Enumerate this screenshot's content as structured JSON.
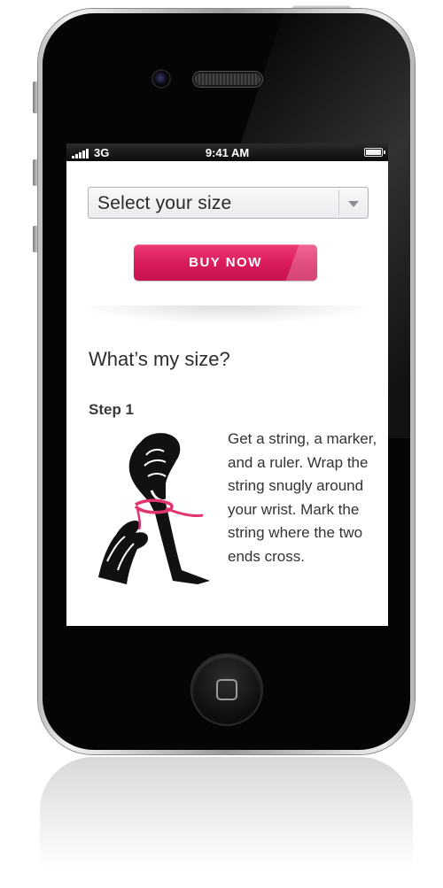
{
  "status_bar": {
    "carrier": "3G",
    "time": "9:41 AM",
    "battery": 1.0
  },
  "size_select": {
    "placeholder": "Select your size"
  },
  "buy_button": {
    "label": "BUY NOW"
  },
  "size_guide": {
    "heading": "What’s my size?",
    "step_title": "Step 1",
    "step_text": "Get a string, a marker, and a ruler. Wrap the string snugly around your wrist. Mark the string where the two ends cross."
  },
  "colors": {
    "accent": "#d81b5b",
    "string": "#e0356f"
  },
  "icons": {
    "status_signal": "signal-bars-icon",
    "status_battery": "battery-icon",
    "select_arrow": "chevron-down-icon",
    "home": "home-button-icon",
    "illustration": "wrist-string-illustration"
  }
}
